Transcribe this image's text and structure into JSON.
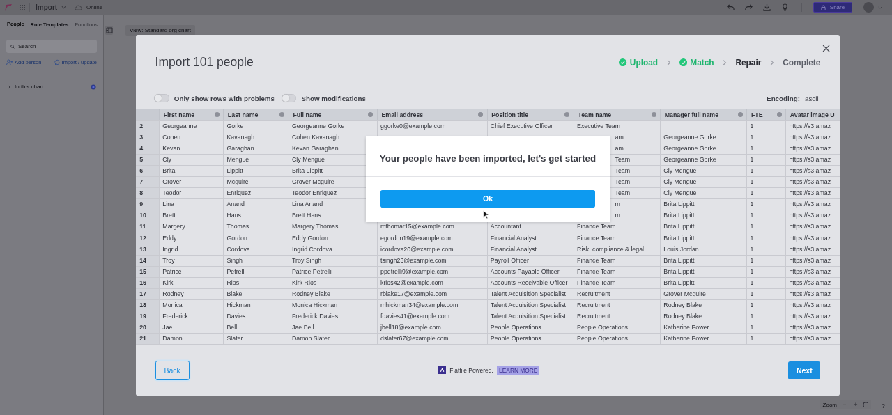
{
  "topbar": {
    "title": "Import",
    "status": "Online",
    "share": "Share"
  },
  "sidebar": {
    "tabs": [
      {
        "label": "People",
        "selected": true
      },
      {
        "label": "Role Templates",
        "selected": false
      },
      {
        "label": "Functions",
        "selected": false,
        "disabled": true
      }
    ],
    "search": {
      "placeholder": "Search"
    },
    "actions": [
      {
        "kind": "add",
        "label": "Add person"
      },
      {
        "kind": "import",
        "label": "Import / update"
      }
    ],
    "section": {
      "label": "In this chart",
      "expanded": false
    }
  },
  "canvas": {
    "view": "View: Standard org chart",
    "zoom": {
      "label": "Zoom",
      "minus": "−",
      "plus": "+"
    },
    "help": "?"
  },
  "modal": {
    "title": "Import 101 people",
    "steps": [
      {
        "label": "Upload",
        "done": true,
        "current": false
      },
      {
        "label": "Match",
        "done": true,
        "current": false
      },
      {
        "label": "Repair",
        "done": false,
        "current": true
      },
      {
        "label": "Complete",
        "done": false,
        "current": false
      }
    ],
    "toggles": [
      {
        "label": "Only show rows with problems",
        "on": false
      },
      {
        "label": "Show modifications",
        "on": false
      }
    ],
    "encoding": {
      "label": "Encoding:",
      "value": "ascii"
    },
    "table": {
      "columns": [
        "First name",
        "Last name",
        "Full name",
        "Email address",
        "Position title",
        "Team name",
        "Manager full name",
        "FTE",
        "Avatar image U"
      ],
      "rows": [
        {
          "num": "2",
          "covered": false,
          "cells": [
            "Georgeanne",
            "Gorke",
            "Georgeanne Gorke",
            "ggorke0@example.com",
            "Chief Executive Officer",
            "Executive Team",
            null,
            "1",
            "https://s3.amaz"
          ]
        },
        {
          "num": "3",
          "covered": true,
          "cells": [
            "Cohen",
            "Kavanagh",
            "Cohen Kavanagh",
            null,
            null,
            "am",
            "Georgeanne Gorke",
            "1",
            "https://s3.amaz"
          ]
        },
        {
          "num": "4",
          "covered": true,
          "cells": [
            "Kevan",
            "Garaghan",
            "Kevan Garaghan",
            null,
            null,
            "am",
            "Georgeanne Gorke",
            "1",
            "https://s3.amaz"
          ]
        },
        {
          "num": "5",
          "covered": true,
          "cells": [
            "Cly",
            "Mengue",
            "Cly Mengue",
            null,
            null,
            "Team",
            "Georgeanne Gorke",
            "1",
            "https://s3.amaz"
          ]
        },
        {
          "num": "6",
          "covered": true,
          "cells": [
            "Brita",
            "Lippitt",
            "Brita Lippitt",
            null,
            null,
            "Team",
            "Cly Mengue",
            "1",
            "https://s3.amaz"
          ]
        },
        {
          "num": "7",
          "covered": true,
          "cells": [
            "Grover",
            "Mcguire",
            "Grover Mcguire",
            null,
            null,
            "Team",
            "Cly Mengue",
            "1",
            "https://s3.amaz"
          ]
        },
        {
          "num": "8",
          "covered": true,
          "cells": [
            "Teodor",
            "Enriquez",
            "Teodor Enriquez",
            null,
            null,
            "Team",
            "Cly Mengue",
            "1",
            "https://s3.amaz"
          ]
        },
        {
          "num": "9",
          "covered": true,
          "cells": [
            "Lina",
            "Anand",
            "Lina Anand",
            null,
            null,
            "m",
            "Brita Lippitt",
            "1",
            "https://s3.amaz"
          ]
        },
        {
          "num": "10",
          "covered": true,
          "cells": [
            "Brett",
            "Hans",
            "Brett Hans",
            null,
            null,
            "m",
            "Brita Lippitt",
            "1",
            "https://s3.amaz"
          ]
        },
        {
          "num": "11",
          "covered": false,
          "cells": [
            "Margery",
            "Thomas",
            "Margery Thomas",
            "mthomar15@example.com",
            "Accountant",
            "Finance Team",
            "Brita Lippitt",
            "1",
            "https://s3.amaz"
          ]
        },
        {
          "num": "12",
          "covered": false,
          "cells": [
            "Eddy",
            "Gordon",
            "Eddy Gordon",
            "egordon19@example.com",
            "Financial Analyst",
            "Finance Team",
            "Brita Lippitt",
            "1",
            "https://s3.amaz"
          ]
        },
        {
          "num": "13",
          "covered": false,
          "cells": [
            "Ingrid",
            "Cordova",
            "Ingrid Cordova",
            "icordova20@example.com",
            "Financial Analyst",
            "Risk, compliance & legal",
            "Louis Jordan",
            "1",
            "https://s3.amaz"
          ]
        },
        {
          "num": "14",
          "covered": false,
          "cells": [
            "Troy",
            "Singh",
            "Troy Singh",
            "tsingh23@example.com",
            "Payroll Officer",
            "Finance Team",
            "Brita Lippitt",
            "1",
            "https://s3.amaz"
          ]
        },
        {
          "num": "15",
          "covered": false,
          "cells": [
            "Patrice",
            "Petrelli",
            "Patrice Petrelli",
            "ppetrelli9@example.com",
            "Accounts Payable Officer",
            "Finance Team",
            "Brita Lippitt",
            "1",
            "https://s3.amaz"
          ]
        },
        {
          "num": "16",
          "covered": false,
          "cells": [
            "Kirk",
            "Rios",
            "Kirk Rios",
            "krios42@example.com",
            "Accounts Receivable Officer",
            "Finance Team",
            "Brita Lippitt",
            "1",
            "https://s3.amaz"
          ]
        },
        {
          "num": "17",
          "covered": false,
          "cells": [
            "Rodney",
            "Blake",
            "Rodney Blake",
            "rblake17@example.com",
            "Talent Acquisition Specialist",
            "Recruitment",
            "Grover Mcguire",
            "1",
            "https://s3.amaz"
          ]
        },
        {
          "num": "18",
          "covered": false,
          "cells": [
            "Monica",
            "Hickman",
            "Monica Hickman",
            "mhickman34@example.com",
            "Talent Acquisition Specialist",
            "Recruitment",
            "Rodney Blake",
            "1",
            "https://s3.amaz"
          ]
        },
        {
          "num": "19",
          "covered": false,
          "cells": [
            "Frederick",
            "Davies",
            "Frederick Davies",
            "fdavies41@example.com",
            "Talent Acquisition Specialist",
            "Recruitment",
            "Rodney Blake",
            "1",
            "https://s3.amaz"
          ]
        },
        {
          "num": "20",
          "covered": false,
          "cells": [
            "Jae",
            "Bell",
            "Jae Bell",
            "jbell18@example.com",
            "People Operations",
            "People Operations",
            "Katherine Power",
            "1",
            "https://s3.amaz"
          ]
        },
        {
          "num": "21",
          "covered": false,
          "cells": [
            "Damon",
            "Slater",
            "Damon Slater",
            "dslater67@example.com",
            "People Operations",
            "People Operations",
            "Katherine Power",
            "1",
            "https://s3.amaz"
          ]
        }
      ]
    },
    "back": "Back",
    "next": "Next",
    "powered": "Flatfile Powered.",
    "learn_more": "LEARN MORE"
  },
  "dialog": {
    "message": "Your people have been imported, let's get started",
    "button": "Ok"
  }
}
